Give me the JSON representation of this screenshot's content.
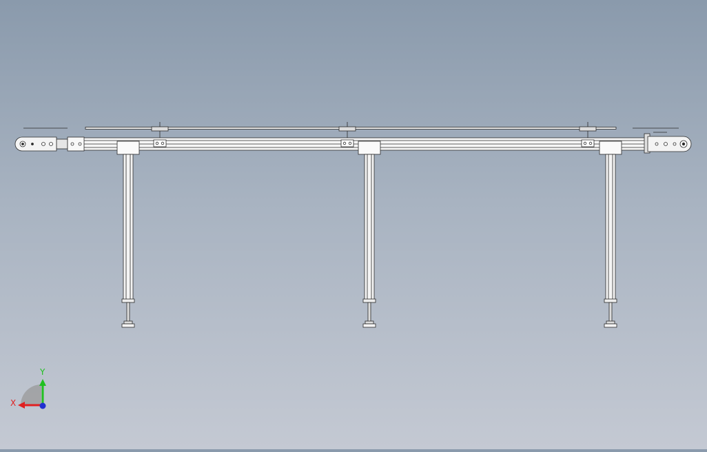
{
  "viewport": {
    "background_top": "#8a9aac",
    "background_bottom": "#c4c9d3"
  },
  "model": {
    "name": "conveyor-front-view",
    "parts": [
      "head-end-plate",
      "tail-end-plate",
      "conveyor-beam",
      "top-guide-rail",
      "support-leg",
      "leveling-foot",
      "guide-clamp"
    ],
    "leg_count": 3,
    "guide_clamp_count": 3,
    "line_color": "#2a2a2a",
    "part_fill": "#f4f4f4"
  },
  "triad": {
    "x_label": "X",
    "y_label": "Y",
    "x_color": "#e02020",
    "y_color": "#20c020",
    "z_color": "#2030d0"
  }
}
